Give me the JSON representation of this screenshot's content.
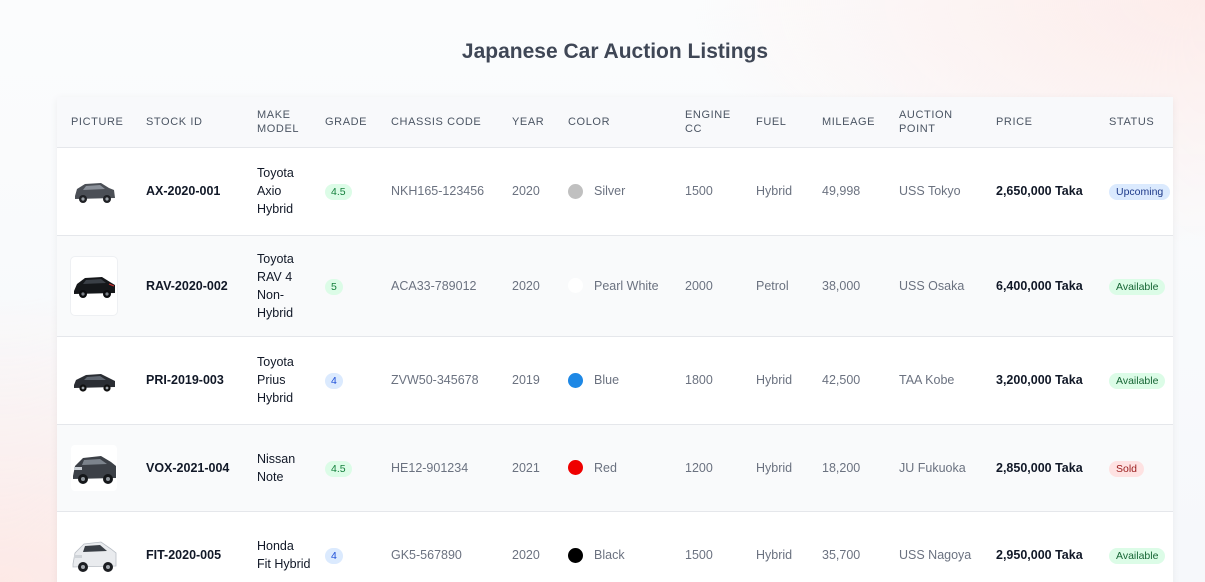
{
  "page": {
    "title": "Japanese Car Auction Listings"
  },
  "table": {
    "headers": [
      "Picture",
      "Stock ID",
      "Make Model",
      "Grade",
      "Chassis Code",
      "Year",
      "Color",
      "Engine CC",
      "Fuel",
      "Mileage",
      "Auction Point",
      "Price",
      "Status"
    ],
    "rows": [
      {
        "picture": "car-thumbnail-suv-dark",
        "stock_id": "AX-2020-001",
        "model": "Toyota Axio Hybrid",
        "grade": "4.5",
        "grade_color": "#dcfce7",
        "chassis": "NKH165-123456",
        "year": "2020",
        "color": "Silver",
        "color_hex": "#c0c0c0",
        "engine_cc": "1500",
        "fuel": "Hybrid",
        "mileage": "49,998",
        "auction_point": "USS Tokyo",
        "price": "2,650,000 Taka",
        "status": "Upcoming"
      },
      {
        "picture": "car-thumbnail-suv-black",
        "stock_id": "RAV-2020-002",
        "model": "Toyota RAV 4 Non-Hybrid",
        "grade": "5",
        "grade_color": "#dcfce7",
        "chassis": "ACA33-789012",
        "year": "2020",
        "color": "Pearl White",
        "color_hex": "#ffffff",
        "engine_cc": "2000",
        "fuel": "Petrol",
        "mileage": "38,000",
        "auction_point": "USS Osaka",
        "price": "6,400,000 Taka",
        "status": "Available"
      },
      {
        "picture": "car-thumbnail-sedan-dark",
        "stock_id": "PRI-2019-003",
        "model": "Toyota Prius Hybrid",
        "grade": "4",
        "grade_color": "#dbeafe",
        "chassis": "ZVW50-345678",
        "year": "2019",
        "color": "Blue",
        "color_hex": "#1e88e5",
        "engine_cc": "1800",
        "fuel": "Hybrid",
        "mileage": "42,500",
        "auction_point": "TAA Kobe",
        "price": "3,200,000 Taka",
        "status": "Available"
      },
      {
        "picture": "car-thumbnail-suv-gray",
        "stock_id": "VOX-2021-004",
        "model": "Nissan Note",
        "grade": "4.5",
        "grade_color": "#dcfce7",
        "chassis": "HE12-901234",
        "year": "2021",
        "color": "Red",
        "color_hex": "#ef0000",
        "engine_cc": "1200",
        "fuel": "Hybrid",
        "mileage": "18,200",
        "auction_point": "JU Fukuoka",
        "price": "2,850,000 Taka",
        "status": "Sold"
      },
      {
        "picture": "car-thumbnail-suv-white",
        "stock_id": "FIT-2020-005",
        "model": "Honda Fit Hybrid",
        "grade": "4",
        "grade_color": "#dbeafe",
        "chassis": "GK5-567890",
        "year": "2020",
        "color": "Black",
        "color_hex": "#000000",
        "engine_cc": "1500",
        "fuel": "Hybrid",
        "mileage": "35,700",
        "auction_point": "USS Nagoya",
        "price": "2,950,000 Taka",
        "status": "Available"
      }
    ]
  }
}
